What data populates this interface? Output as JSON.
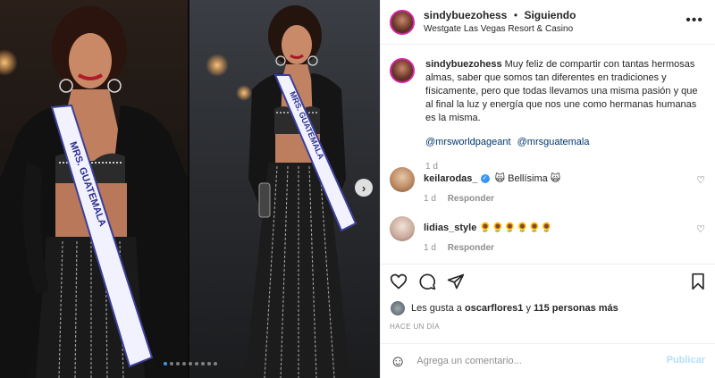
{
  "post": {
    "username": "sindybuezohess",
    "separator": "•",
    "following_label": "Siguiendo",
    "location": "Westgate Las Vegas Resort & Casino"
  },
  "caption": {
    "username": "sindybuezohess",
    "text": "Muy feliz de compartir con tantas hermosas almas, saber que somos tan diferentes en tradiciones y físicamente, pero que todas llevamos una misma pasión y que al final la luz y energía que nos une como hermanas humanas es la misma.",
    "tags": [
      "@mrsworldpageant",
      "@mrsguatemala"
    ],
    "time": "1 d"
  },
  "comments": [
    {
      "username": "keilarodas_",
      "text": "🙀 Bellísima 🙀",
      "time": "1 d",
      "reply_label": "Responder",
      "verified": true
    },
    {
      "username": "lidias_style",
      "text": "🌻🌻🌻🌻🌻🌻",
      "time": "1 d",
      "reply_label": "Responder",
      "verified": false
    }
  ],
  "likes": {
    "prefix": "Les gusta a",
    "user": "oscarflores1",
    "connector": "y",
    "others": "115 personas más"
  },
  "timestamp": "HACE UN DÍA",
  "composer": {
    "placeholder": "Agrega un comentario...",
    "publish_label": "Publicar"
  },
  "carousel": {
    "count": 9,
    "active_index": 0
  },
  "sash_text": "MRS. GUATEMALA",
  "colors": {
    "link": "#00376b",
    "accent": "#3897f0",
    "muted": "#8e8e8e",
    "publish_disabled": "#b2dffc"
  }
}
